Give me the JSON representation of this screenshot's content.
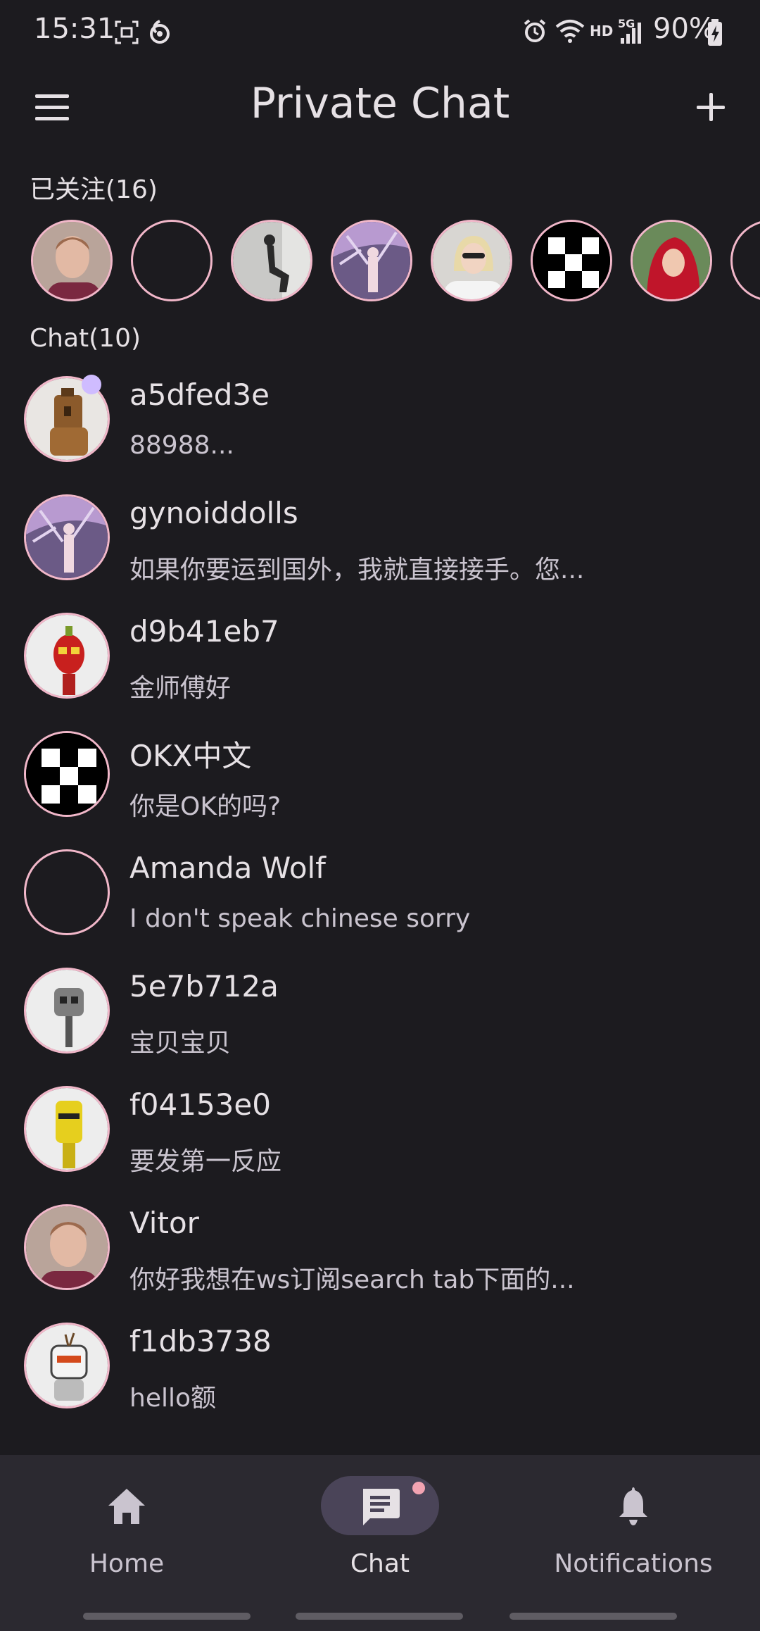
{
  "status_bar": {
    "time": "15:31",
    "battery": "90%",
    "icons": [
      "screenshot-icon",
      "sync-icon",
      "alarm-icon",
      "wifi-icon",
      "hd-icon",
      "signal-5g-icon",
      "battery-charging-icon"
    ],
    "hd_label": "HD",
    "net_label": "5G"
  },
  "app_bar": {
    "title": "Private Chat",
    "menu_icon": "hamburger-menu-icon",
    "add_icon": "plus-icon"
  },
  "following": {
    "label": "已关注(16)",
    "avatars": [
      "avatar-man",
      "avatar-empty",
      "avatar-photo-sitting",
      "avatar-purple-figure",
      "avatar-woman-blonde",
      "avatar-checker",
      "avatar-red-hood",
      "avatar-partial"
    ]
  },
  "chats": {
    "label": "Chat(10)",
    "items": [
      {
        "name": "a5dfed3e",
        "message": "88988...",
        "avatar": "robot-brown"
      },
      {
        "name": "gynoiddolls",
        "message": "如果你要运到国外，我就直接接手。您...",
        "avatar": "purple-figure"
      },
      {
        "name": "d9b41eb7",
        "message": "金师傅好",
        "avatar": "robot-red"
      },
      {
        "name": "OKX中文",
        "message": "你是OK的吗?",
        "avatar": "checker"
      },
      {
        "name": "Amanda Wolf",
        "message": "I don't speak chinese sorry",
        "avatar": "empty"
      },
      {
        "name": "5e7b712a",
        "message": "宝贝宝贝",
        "avatar": "robot-gray"
      },
      {
        "name": "f04153e0",
        "message": "要发第一反应",
        "avatar": "robot-yellow"
      },
      {
        "name": "Vitor",
        "message": "你好我想在ws订阅search tab下面的...",
        "avatar": "man"
      },
      {
        "name": "f1db3738",
        "message": "hello额",
        "avatar": "robot-white"
      }
    ]
  },
  "bottom_nav": {
    "items": [
      {
        "label": "Home",
        "icon": "home-icon"
      },
      {
        "label": "Chat",
        "icon": "chat-icon",
        "selected": true,
        "badge": true
      },
      {
        "label": "Notifications",
        "icon": "bell-icon"
      }
    ]
  },
  "colors": {
    "background": "#1c1b1f",
    "avatar_ring": "#f1b7c9",
    "online_dot": "#cfbcff",
    "nav_background": "#2b2930",
    "nav_selected_pill": "#4a4458",
    "badge": "#f2a3b2"
  }
}
